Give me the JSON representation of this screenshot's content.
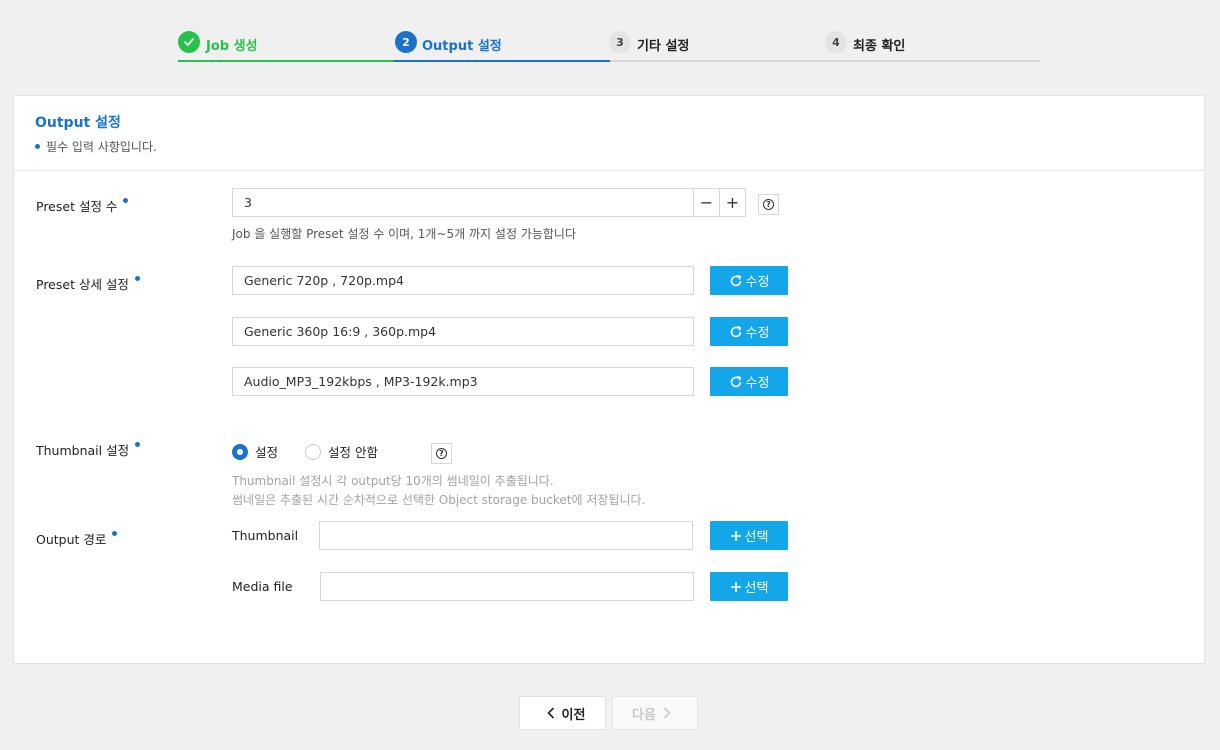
{
  "steps": [
    {
      "number": "",
      "label": "Job 생성",
      "state": "done"
    },
    {
      "number": "2",
      "label": "Output 설정",
      "state": "active"
    },
    {
      "number": "3",
      "label": "기타 설정",
      "state": "pending"
    },
    {
      "number": "4",
      "label": "최종 확인",
      "state": "pending"
    }
  ],
  "panel": {
    "title": "Output 설정",
    "required_note": "필수 입력 사항입니다."
  },
  "preset_count": {
    "label": "Preset 설정 수",
    "value": "3",
    "minus": "−",
    "plus": "+",
    "hint": "Job 을 실행할 Preset 설정 수 이며, 1개~5개 까지 설정 가능합니다"
  },
  "preset_detail": {
    "label": "Preset 상세 설정",
    "items": [
      {
        "value": "Generic 720p , 720p.mp4",
        "button": "수정"
      },
      {
        "value": "Generic 360p 16:9 , 360p.mp4",
        "button": "수정"
      },
      {
        "value": "Audio_MP3_192kbps , MP3-192k.mp3",
        "button": "수정"
      }
    ]
  },
  "thumbnail": {
    "label": "Thumbnail 설정",
    "option_on": "설정",
    "option_off": "설정 안함",
    "selected": "on",
    "hint_1": "Thumbnail 설정시 각 output당 10개의 썸네일이 추출됩니다.",
    "hint_2": "썸네일은 추출된 시간 순차적으로 선택한 Object storage bucket에 저장됩니다."
  },
  "output_path": {
    "label": "Output 경로",
    "thumbnail_label": "Thumbnail",
    "thumbnail_value": "",
    "media_label": "Media file",
    "media_value": "",
    "select_button": "선택"
  },
  "nav": {
    "prev": "이전",
    "next": "다음"
  },
  "colors": {
    "primary": "#1a73c9",
    "success": "#27c24c",
    "button": "#13a6e8"
  }
}
